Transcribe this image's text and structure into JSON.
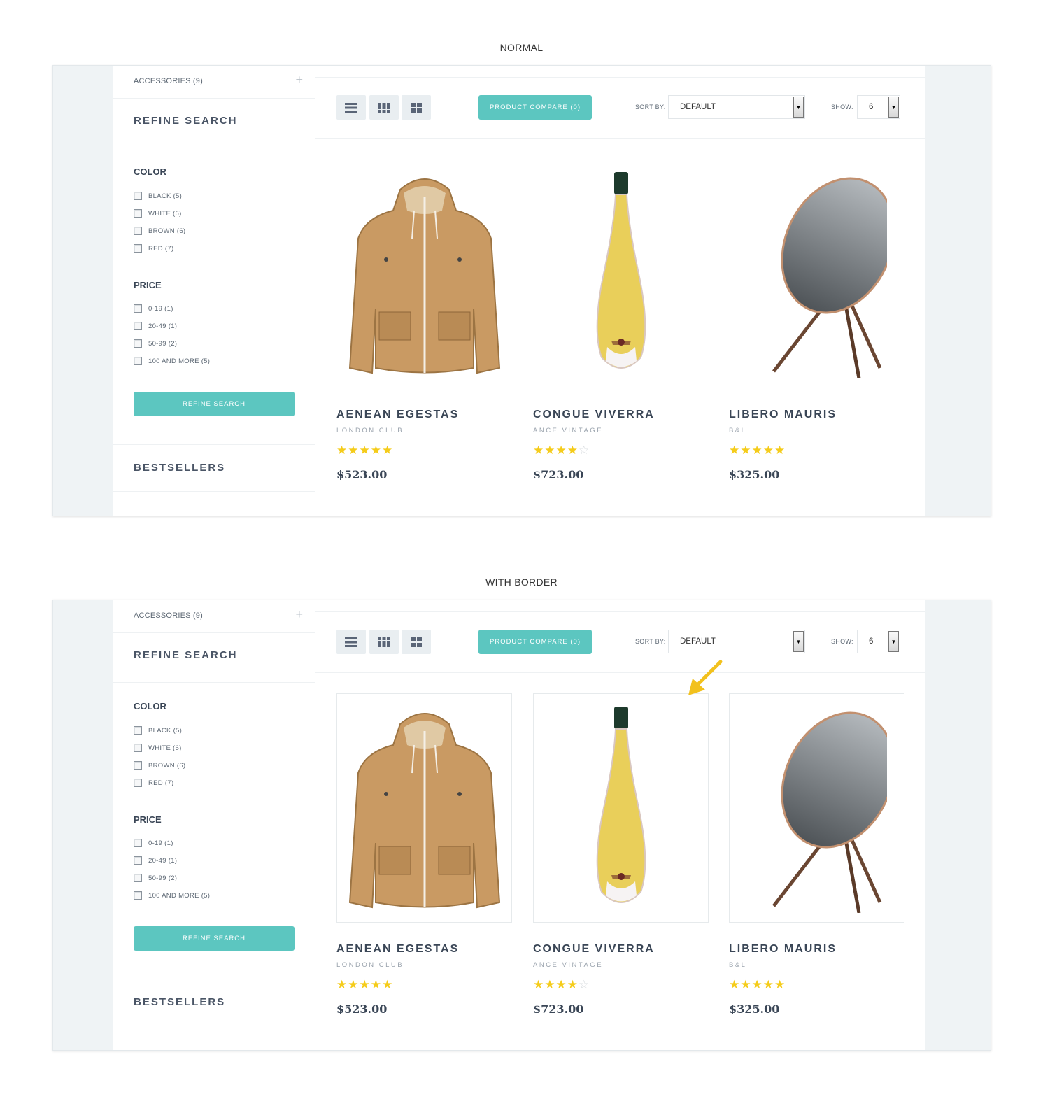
{
  "sections": [
    {
      "title": "NORMAL",
      "bordered": false
    },
    {
      "title": "WITH BORDER",
      "bordered": true
    }
  ],
  "sidebar": {
    "accessories": "ACCESSORIES (9)",
    "refine_heading": "REFINE SEARCH",
    "color_title": "COLOR",
    "colors": [
      "BLACK (5)",
      "WHITE (6)",
      "BROWN (6)",
      "RED (7)"
    ],
    "price_title": "PRICE",
    "prices": [
      "0-19 (1)",
      "20-49 (1)",
      "50-99 (2)",
      "100 AND MORE (5)"
    ],
    "refine_button": "REFINE SEARCH",
    "bestsellers_heading": "BESTSELLERS"
  },
  "toolbar": {
    "compare_button": "PRODUCT COMPARE (0)",
    "sort_label": "SORT BY:",
    "sort_value": "DEFAULT",
    "show_label": "SHOW:",
    "show_value": "6"
  },
  "products": [
    {
      "name": "AENEAN EGESTAS",
      "brand": "LONDON CLUB",
      "rating": 5,
      "price": "$523.00",
      "image": "jacket"
    },
    {
      "name": "CONGUE VIVERRA",
      "brand": "ANCE VINTAGE",
      "rating": 4,
      "price": "$723.00",
      "image": "bottle"
    },
    {
      "name": "LIBERO MAURIS",
      "brand": "B&L",
      "rating": 5,
      "price": "$325.00",
      "image": "speaker"
    }
  ],
  "colors": {
    "accent": "#5cc6c0",
    "star": "#f5cc1a",
    "arrow": "#f2c11d"
  }
}
